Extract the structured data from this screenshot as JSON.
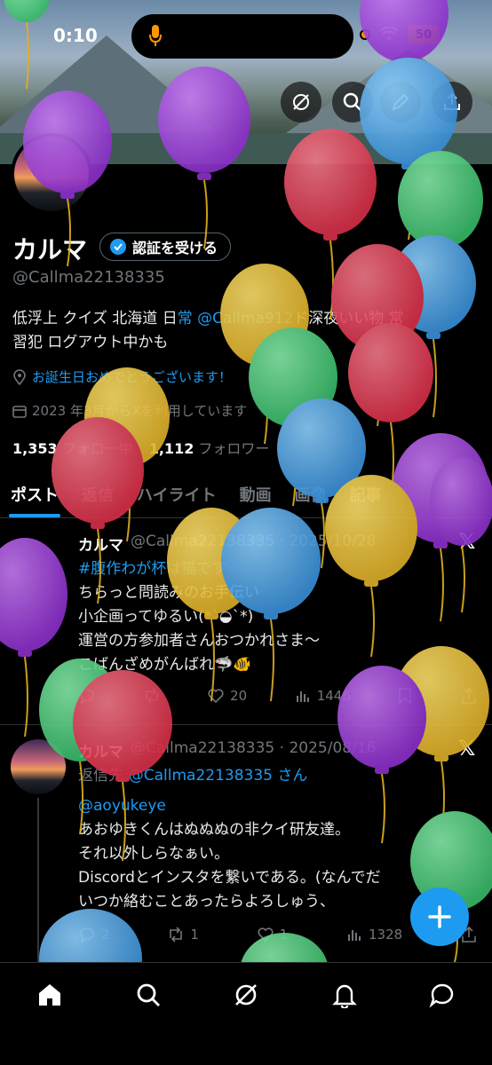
{
  "status": {
    "time": "0:10",
    "battery": "50"
  },
  "profile": {
    "name": "カルマ",
    "verify_label": "認証を受ける",
    "handle": "@Callma22138335",
    "bio_line1_a": "低浮上 クイズ 北海道 日",
    "bio_line1_link": "常 @Callma912",
    "bio_line1_b": "ド深夜いい物 常",
    "bio_line2": "習犯 ログアウト中かも",
    "birthday": "お誕生日おめでとうございます！",
    "joined": "2023 年3月からXを利用しています",
    "following_count": "1,353",
    "following_label": "フォロー中",
    "followers_count": "1,112",
    "followers_label": "フォロワー"
  },
  "tabs": [
    "ポスト",
    "返信",
    "ハイライト",
    "動画",
    "画像",
    "記事"
  ],
  "posts": [
    {
      "name": "カルマ",
      "meta": "@Callma22138335 · 2025/10/28",
      "lines": [
        "#腹作わが杯は猫です",
        "ちらっと問読みのお手伝い",
        "小企画ってゆるい(*`◒`*)",
        "運営の方参加者さんおつかれさま〜",
        "こばんざめがんばれ🦈🐠"
      ],
      "likes": "20",
      "views": "1446"
    },
    {
      "name": "カルマ",
      "meta": "@Callma22138335 · 2025/08/16",
      "reply_prefix": "返信先:",
      "reply_to": "@Callma22138335 さん",
      "mention": "@aoyukeye",
      "lines": [
        "あおゆきくんはぬぬぬの非クイ研友達。",
        "それ以外しらなぁい。",
        "Discordとインスタを繋いである。(なんでだ",
        "いつか絡むことあったらよろしゅう、"
      ],
      "replies": "2",
      "reposts": "1",
      "likes": "1",
      "views": "1328"
    }
  ],
  "colors": {
    "accent": "#1d9bf0",
    "background": "#000000"
  }
}
